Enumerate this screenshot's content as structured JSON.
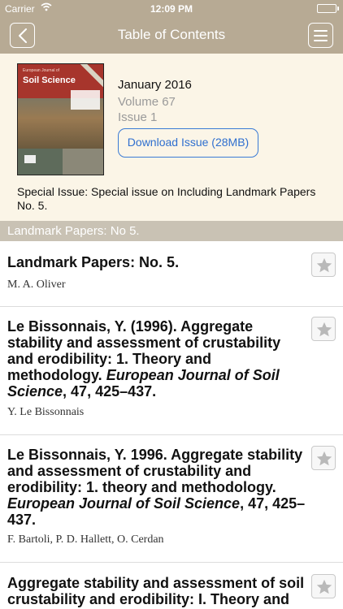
{
  "status_bar": {
    "carrier": "Carrier",
    "time": "12:09 PM",
    "battery_level": 1.0
  },
  "navbar": {
    "title": "Table of Contents",
    "back_icon": "chevron-left-icon",
    "menu_icon": "hamburger-menu-icon",
    "bar_color": "#b7aa94"
  },
  "issue": {
    "cover_title": "Soil Science",
    "cover_subtitle": "European Journal of",
    "date": "January 2016",
    "volume": "Volume 67",
    "issue": "Issue 1",
    "download_label": "Download Issue (28MB)",
    "special": "Special Issue: Special issue on Including Landmark Papers No. 5."
  },
  "section": {
    "title": "Landmark Papers: No 5."
  },
  "articles": [
    {
      "title": "Landmark Papers: No. 5.",
      "title_journal": "",
      "title_suffix": "",
      "authors": "M. A. Oliver"
    },
    {
      "title": "Le Bissonnais, Y. (1996). Aggregate stability and assessment of crustability and erodibility: 1. Theory and methodology.",
      "title_journal": "European Journal of Soil Science",
      "title_suffix": ", 47, 425–437.",
      "authors": "Y. Le Bissonnais"
    },
    {
      "title": "Le Bissonnais, Y. 1996. Aggregate stability and assessment of crustability and erodibility: 1. theory and methodology.",
      "title_journal": "European Journal of Soil Science",
      "title_suffix": ", 47, 425–437.",
      "authors": "F. Bartoli, P. D. Hallett, O. Cerdan"
    },
    {
      "title": "Aggregate stability and assessment of soil crustability and erodibility: I. Theory and methodology",
      "title_journal": "",
      "title_suffix": "",
      "authors": ""
    }
  ],
  "colors": {
    "accent": "#3a7bd5",
    "panel": "#fbf5e7",
    "section_header": "#c9c2b4"
  }
}
